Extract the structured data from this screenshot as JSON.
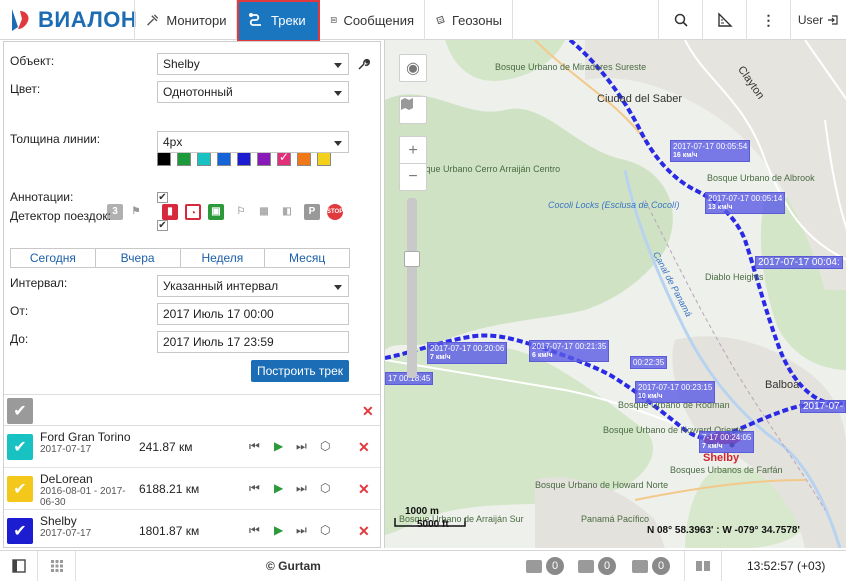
{
  "header": {
    "logo_text": "ВИАЛОН",
    "nav": [
      {
        "label": "Мониторинг",
        "icon": "monitoring-icon"
      },
      {
        "label": "Треки",
        "icon": "tracks-icon",
        "active": true
      },
      {
        "label": "Сообщения",
        "icon": "messages-icon"
      },
      {
        "label": "Геозоны",
        "icon": "geozones-icon"
      }
    ],
    "user_label": "User"
  },
  "form": {
    "object_label": "Объект:",
    "object_value": "Shelby",
    "color_label": "Цвет:",
    "color_value": "Однотонный",
    "swatches": [
      "#000000",
      "#1a9a3a",
      "#19c2c2",
      "#1565d8",
      "#1c1cd0",
      "#8a1ab8",
      "#e0307a",
      "#f07818",
      "#f3d01b"
    ],
    "selected_swatch": 6,
    "width_label": "Толщина линии:",
    "width_value": "4px",
    "annotations_icon_badge": "3",
    "annotations_label": "Аннотации:",
    "annotations_checked": true,
    "trips_label": "Детектор поездок:",
    "trips_checked": true,
    "tabs": [
      "Сегодня",
      "Вчера",
      "Неделя",
      "Месяц"
    ],
    "interval_label": "Интервал:",
    "interval_value": "Указанный интервал",
    "from_label": "От:",
    "from_value": "2017 Июль 17 00:00",
    "to_label": "До:",
    "to_value": "2017 Июль 17 23:59",
    "build_button": "Построить трек"
  },
  "tracks": [
    {
      "name": "Ford Gran Torino",
      "date": "2017-07-17",
      "distance": "241.87 км",
      "color": "#19c2c2"
    },
    {
      "name": "DeLorean",
      "date": "2016-08-01 - 2017-06-30",
      "distance": "6188.21 км",
      "color": "#f3c81b"
    },
    {
      "name": "Shelby",
      "date": "2017-07-17",
      "distance": "1801.87 км",
      "color": "#1c1cd0"
    }
  ],
  "map": {
    "labels": [
      {
        "text": "Bosque Urbano de Miradores Sureste",
        "cls": ""
      },
      {
        "text": "Clayton",
        "cls": "big"
      },
      {
        "text": "Ciudad del Saber",
        "cls": "big"
      },
      {
        "text": "Cocoli Locks (Esclusa de Cocolí)",
        "cls": "water"
      },
      {
        "text": "Bosque Urbano de Albrook",
        "cls": ""
      },
      {
        "text": "Diablo Heights",
        "cls": ""
      },
      {
        "text": "Canal de Panamá",
        "cls": "water"
      },
      {
        "text": "Bosque Urbano Cerro Arraiján Centro",
        "cls": ""
      },
      {
        "text": "Bosque Urbano de Howard Oriente",
        "cls": ""
      },
      {
        "text": "Bosque Urbano de Howard Norte",
        "cls": ""
      },
      {
        "text": "Bosques Urbanos de Farfán",
        "cls": ""
      },
      {
        "text": "Panamá Pacífico",
        "cls": ""
      },
      {
        "text": "Bosque Urbano de Arraiján Sur",
        "cls": ""
      },
      {
        "text": "Bosque Urbano de Rodman",
        "cls": ""
      },
      {
        "text": "Balboa",
        "cls": "big"
      }
    ],
    "points": [
      {
        "time": "2017-07-17 00:05:54",
        "speed": "16 км/ч"
      },
      {
        "time": "2017-07-17 00:05:14",
        "speed": "13 км/ч"
      },
      {
        "time": "2017-07-17 00:04:",
        "speed": ""
      },
      {
        "time": "2017-07-17 00:20:06",
        "speed": "7 км/ч"
      },
      {
        "time": "2017-07-17 00:21:35",
        "speed": "6 км/ч"
      },
      {
        "time": "00:22:35",
        "speed": ""
      },
      {
        "time": "2017-07-17 00:23:15",
        "speed": "10 км/ч"
      },
      {
        "time": "17 00:18:45",
        "speed": ""
      },
      {
        "time": "2017-07-",
        "speed": ""
      },
      {
        "time": "7-17 00:24:05",
        "speed": "7 км/ч"
      }
    ],
    "car_label": "Shelby",
    "scale_m": "1000 m",
    "scale_ft": "5000 ft",
    "coords": "N 08° 58.3963' : W -079° 34.7578'"
  },
  "footer": {
    "copyright": "© Gurtam",
    "counters": [
      "0",
      "0",
      "0"
    ],
    "clock": "13:52:57 (+03)"
  }
}
